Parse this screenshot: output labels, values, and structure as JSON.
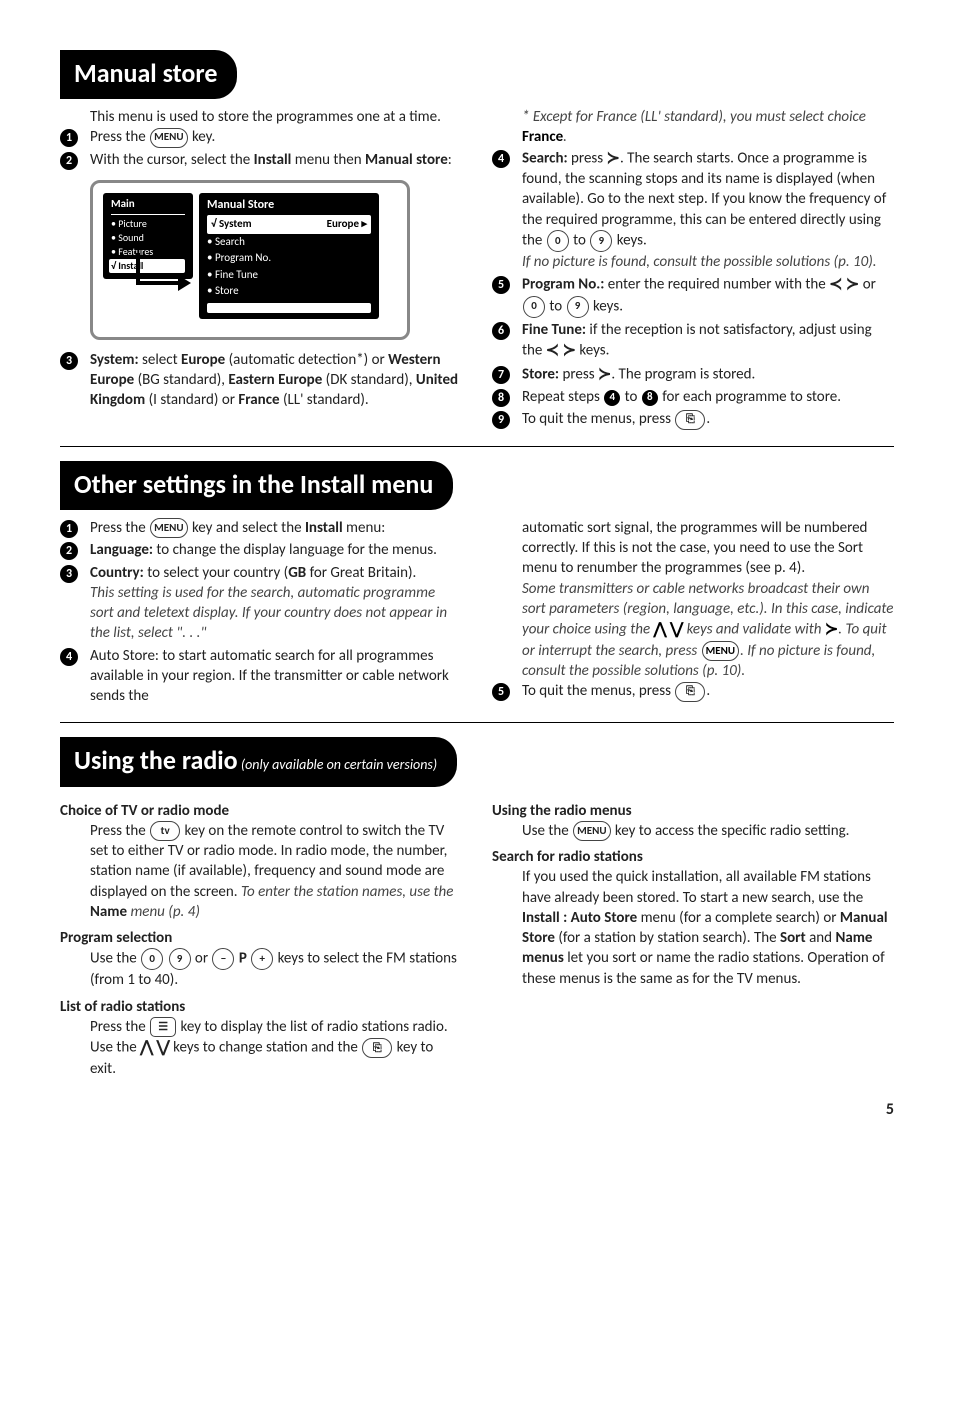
{
  "sections": {
    "manual_store": {
      "title": "Manual store",
      "intro": "This menu is used to store the programmes one at a time.",
      "left_steps": {
        "s1": {
          "text": "Press the ",
          "key": "MENU",
          "suffix": " key."
        },
        "s2": {
          "text_a": "With the cursor, select the ",
          "bold_a": "Install",
          "text_b": " menu then ",
          "bold_b": "Manual store",
          "text_c": ":"
        },
        "s3": {
          "bold_a": "System:",
          "text_a": " select ",
          "bold_b": "Europe",
          "text_b": " (automatic detection*) or ",
          "bold_c": "Western Europe",
          "text_c": " (BG standard), ",
          "bold_d": "Eastern Europe",
          "text_d": " (DK standard), ",
          "bold_e": "United Kingdom",
          "text_e": " (I standard) or ",
          "bold_f": "France",
          "text_f": " (LL' standard)."
        }
      },
      "right_note": {
        "text_a": "* Except for France (LL' standard), you must select choice ",
        "bold": "France",
        "text_b": "."
      },
      "right_steps": {
        "s4": {
          "bold_a": "Search:",
          "text_a": " press ",
          "sym": "≻",
          "text_b": ". The search starts. Once a programme is found, the scanning stops and its name is displayed (when available). Go to the next step. If you know the frequency of the required programme, this can be entered directly using the ",
          "key_a": "0",
          "mid": " to ",
          "key_b": "9",
          "text_c": " keys.",
          "italic": "If no picture is found, consult the possible solutions (p. 10)."
        },
        "s5": {
          "bold_a": "Program No.:",
          "text_a": " enter the required number with the ",
          "sym_a": "≺",
          "sym_b": "≻",
          "text_b": " or ",
          "key_a": "0",
          "mid": " to ",
          "key_b": "9",
          "text_c": " keys."
        },
        "s6": {
          "bold_a": "Fine Tune:",
          "text_a": " if the reception is not satisfactory, adjust using the ",
          "sym_a": "≺",
          "sym_b": "≻",
          "text_b": " keys."
        },
        "s7": {
          "bold_a": "Store:",
          "text_a": " press ",
          "sym": "≻",
          "text_b": ". The program is stored."
        },
        "s8": {
          "text_a": "Repeat steps ",
          "ref_a": "4",
          "mid": " to ",
          "ref_b": "8",
          "text_b": " for each programme to store."
        },
        "s9": {
          "text_a": "To quit the menus, press ",
          "key": "⎘",
          "text_b": "."
        }
      },
      "menu_diagram": {
        "main_title": "Main",
        "main_items": [
          "• Picture",
          "• Sound",
          "• Features"
        ],
        "main_sel": "√ Install",
        "sub_title": "Manual Store",
        "sub_sel_left": "√ System",
        "sub_sel_right": "Europe ▸",
        "sub_items": [
          "• Search",
          "• Program No.",
          "• Fine Tune",
          "• Store"
        ]
      }
    },
    "other_settings": {
      "title": "Other settings in the Install menu",
      "left": {
        "s1": {
          "text_a": "Press the ",
          "key": "MENU",
          "text_b": " key and select the ",
          "bold": "Install",
          "text_c": " menu:"
        },
        "s2": {
          "bold": "Language:",
          "text": " to change the display language for the menus."
        },
        "s3": {
          "bold_a": "Country:",
          "text_a": " to select your country (",
          "bold_b": "GB",
          "text_b": " for Great Britain).",
          "italic": "This setting is used for the search, automatic programme sort and teletext display. If your country does not appear in the list, select \". . .\""
        },
        "s4": {
          "text": "Auto Store: to start automatic search for all programmes available in your region. If the transmitter or cable network sends the"
        }
      },
      "right": {
        "cont": "automatic sort signal, the programmes will be numbered correctly. If this is not the case, you need to use the Sort menu to renumber the programmes (see p. 4).",
        "italic_a": "Some transmitters or cable networks broadcast their own sort parameters (region, language, etc.). In this case, indicate your choice using the ",
        "sym_up": "⋀",
        "sym_down": "⋁",
        "italic_b": " keys and validate with ",
        "sym_r": "≻",
        "italic_c": ". To quit or interrupt the search, press ",
        "key": "MENU",
        "italic_d": ". If no picture is found, consult the possible solutions (p. 10).",
        "s5": {
          "text_a": "To quit the menus, press ",
          "key": "⎘",
          "text_b": "."
        }
      }
    },
    "radio": {
      "title_a": "Using the radio",
      "title_b": " (only available on certain versions)",
      "left": {
        "h1": "Choice of TV or radio mode",
        "p1_a": "Press the ",
        "key1": "tv",
        "p1_b": " key on the remote control to switch the TV set to either TV or radio mode. In radio mode, the number, station name (if available), frequency and sound mode are displayed on the screen. ",
        "p1_italic_a": "To enter the station names, use the ",
        "p1_bold": "Name",
        "p1_italic_b": " menu (p. 4)",
        "h2": "Program selection",
        "p2_a": "Use the ",
        "k09a": "0",
        "k09b": "9",
        "p2_b": " or ",
        "kminus": "−",
        "p2_p": " P ",
        "kplus": "+",
        "p2_c": " keys to select the FM stations (from 1 to 40).",
        "h3": "List of radio stations",
        "p3_a": "Press the ",
        "klist": "☰",
        "p3_b": " key to display the list of radio stations radio. Use the ",
        "sym_up": "⋀",
        "sym_down": "⋁",
        "p3_c": " keys to change station and the ",
        "kexit": "⎘",
        "p3_d": " key to exit."
      },
      "right": {
        "h1": "Using the radio menus",
        "p1_a": "Use the ",
        "key1": "MENU",
        "p1_b": " key to access the specific radio setting.",
        "h2": "Search for radio stations",
        "p2_a": "If you used the quick installation, all available FM stations have already been stored. To start a new search, use the ",
        "b1": "Install : Auto Store",
        "p2_b": " menu (for a complete search) or ",
        "b2": "Manual Store",
        "p2_c": " (for a station by station search). The ",
        "b3": "Sort",
        "p2_d": " and ",
        "b4": "Name menus",
        "p2_e": " let you sort or name the radio stations. Operation of these menus is the same as for the TV menus."
      }
    }
  },
  "pagenum": "5"
}
